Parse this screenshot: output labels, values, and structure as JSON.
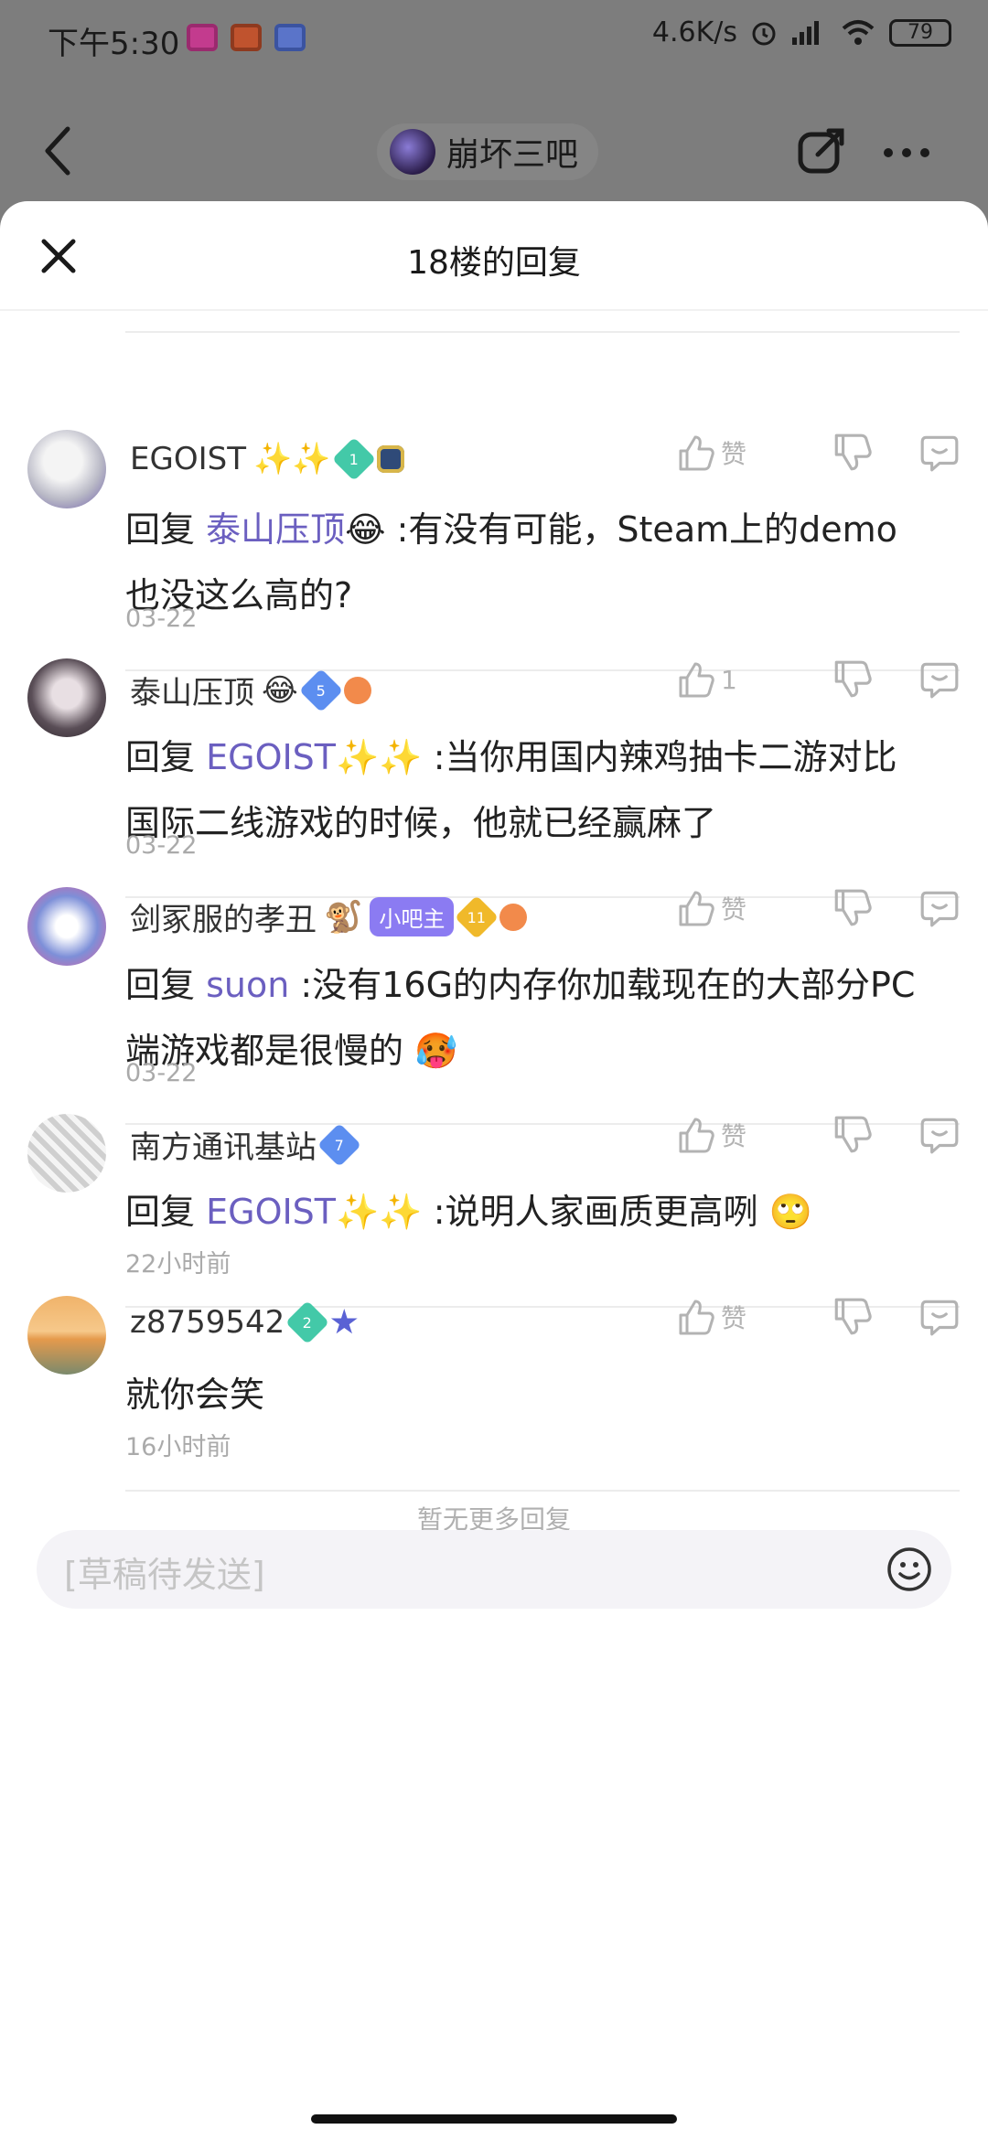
{
  "status_bar": {
    "time": "下午5:30",
    "speed": "4.6K/s",
    "battery": "79"
  },
  "forum": {
    "name": "崩坏三吧"
  },
  "sheet": {
    "title": "18楼的回复"
  },
  "replies": [
    {
      "username": "EGOIST",
      "reply_prefix": "回复",
      "mention": "泰山压顶",
      "text_line1": " :有没有可能，Steam上的demo",
      "text_line2": "也没这么高的?",
      "date": "03-22",
      "like_label": "赞",
      "level": "1"
    },
    {
      "username": "泰山压顶",
      "reply_prefix": "回复",
      "mention": "EGOIST",
      "text_line1": " :当你用国内辣鸡抽卡二游对比",
      "text_line2": "国际二线游戏的时候，他就已经赢麻了",
      "date": "03-22",
      "like_label": "1",
      "level": "5"
    },
    {
      "username": "剑冢服的孝丑",
      "owner_tag": "小吧主",
      "reply_prefix": "回复",
      "mention": "suon",
      "text_line1": " :没有16G的内存你加载现在的大部分PC",
      "text_line2": "端游戏都是很慢的",
      "date": "03-22",
      "like_label": "赞",
      "level": "11"
    },
    {
      "username": "南方通讯基站",
      "reply_prefix": "回复",
      "mention": "EGOIST",
      "text_line1": " :说明人家画质更高咧",
      "date": "22小时前",
      "like_label": "赞",
      "level": "7"
    },
    {
      "username": "z8759542",
      "text_line1": "就你会笑",
      "date": "16小时前",
      "like_label": "赞",
      "level": "2"
    }
  ],
  "footer": {
    "no_more": "暂无更多回复",
    "input_placeholder": "[草稿待发送]"
  },
  "colors": {
    "accent": "#6b5fc0",
    "owner_tag": "#8b7bf2"
  },
  "icons": [
    "back-icon",
    "share-icon",
    "more-icon",
    "close-icon",
    "thumbs-up-icon",
    "thumbs-down-icon",
    "comment-icon",
    "emoji-icon"
  ]
}
